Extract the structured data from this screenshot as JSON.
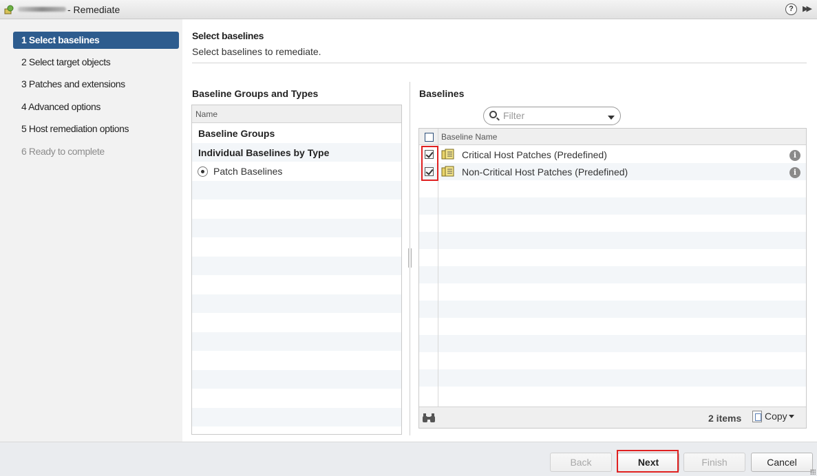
{
  "window": {
    "title": "- Remediate",
    "help_glyph": "?",
    "expand_glyph": "▶▶"
  },
  "steps": [
    {
      "label": "1  Select baselines",
      "state": "active"
    },
    {
      "label": "2  Select target objects",
      "state": "normal"
    },
    {
      "label": "3  Patches and extensions",
      "state": "normal"
    },
    {
      "label": "4  Advanced options",
      "state": "normal"
    },
    {
      "label": "5  Host remediation options",
      "state": "normal"
    },
    {
      "label": "6  Ready to complete",
      "state": "disabled"
    }
  ],
  "page": {
    "title": "Select baselines",
    "subtitle": "Select baselines to remediate."
  },
  "groups_panel": {
    "heading": "Baseline Groups and Types",
    "column_header": "Name",
    "rows": [
      {
        "label": "Baseline Groups",
        "kind": "group"
      },
      {
        "label": "Individual Baselines by Type",
        "kind": "group"
      },
      {
        "label": "Patch Baselines",
        "kind": "type",
        "selected": true
      }
    ]
  },
  "baselines_panel": {
    "heading": "Baselines",
    "filter_placeholder": "Filter",
    "column_header": "Baseline Name",
    "rows": [
      {
        "name": "Critical Host Patches (Predefined)",
        "checked": true
      },
      {
        "name": "Non-Critical Host Patches (Predefined)",
        "checked": true
      }
    ],
    "info_glyph": "i",
    "item_count": "2 items",
    "copy_label": "Copy"
  },
  "buttons": {
    "back": "Back",
    "next": "Next",
    "finish": "Finish",
    "cancel": "Cancel"
  },
  "colors": {
    "active_step": "#2d5c8e",
    "highlight": "#e02020",
    "row_stripe": "#f3f6f9"
  }
}
